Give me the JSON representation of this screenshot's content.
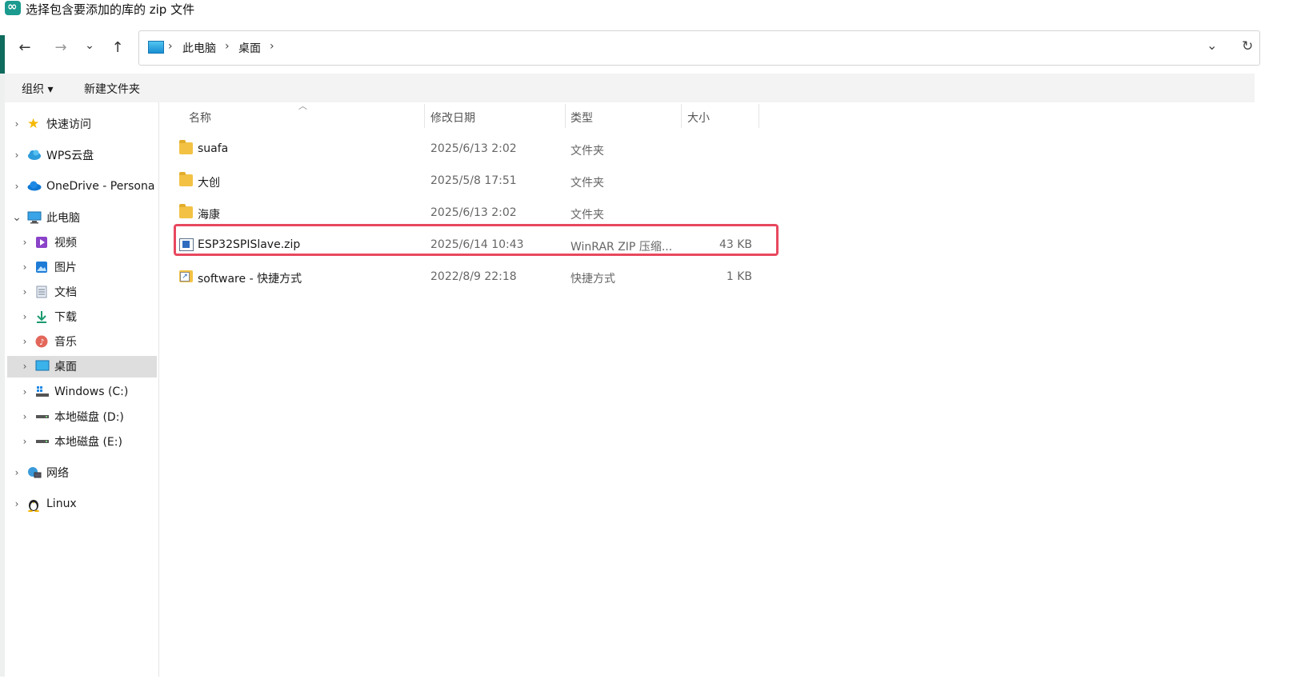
{
  "window": {
    "title": "选择包含要添加的库的 zip 文件"
  },
  "nav": {
    "back_icon": "←",
    "forward_icon": "→",
    "recent_icon": "⌄",
    "up_icon": "↑",
    "breadcrumb": [
      "此电脑",
      "桌面"
    ],
    "sep": "›",
    "dropdown_icon": "⌄",
    "refresh_icon": "↻"
  },
  "toolbar": {
    "organize_label": "组织 ▾",
    "new_folder_label": "新建文件夹"
  },
  "sidebar": {
    "items": [
      {
        "label": "快速访问",
        "expanded": false
      },
      {
        "label": "WPS云盘",
        "expanded": false
      },
      {
        "label": "OneDrive - Persona",
        "expanded": false
      },
      {
        "label": "此电脑",
        "expanded": true
      },
      {
        "label": "视频",
        "expanded": false
      },
      {
        "label": "图片",
        "expanded": false
      },
      {
        "label": "文档",
        "expanded": false
      },
      {
        "label": "下载",
        "expanded": false
      },
      {
        "label": "音乐",
        "expanded": false
      },
      {
        "label": "桌面",
        "expanded": false,
        "selected": true
      },
      {
        "label": "Windows (C:)",
        "expanded": false
      },
      {
        "label": "本地磁盘 (D:)",
        "expanded": false
      },
      {
        "label": "本地磁盘 (E:)",
        "expanded": false
      },
      {
        "label": "网络",
        "expanded": false
      },
      {
        "label": "Linux",
        "expanded": false
      }
    ],
    "chev_collapsed": "›",
    "chev_expanded": "⌄"
  },
  "columns": {
    "name": "名称",
    "modified": "修改日期",
    "type": "类型",
    "size": "大小"
  },
  "files": [
    {
      "name": "suafa",
      "modified": "2025/6/13 2:02",
      "type": "文件夹",
      "size": "",
      "icon": "folder-icon"
    },
    {
      "name": "大创",
      "modified": "2025/5/8 17:51",
      "type": "文件夹",
      "size": "",
      "icon": "folder-icon"
    },
    {
      "name": "海康",
      "modified": "2025/6/13 2:02",
      "type": "文件夹",
      "size": "",
      "icon": "folder-icon"
    },
    {
      "name": "ESP32SPISlave.zip",
      "modified": "2025/6/14 10:43",
      "type": "WinRAR ZIP 压缩...",
      "size": "43 KB",
      "icon": "zip-file-icon",
      "highlighted": true
    },
    {
      "name": "software - 快捷方式",
      "modified": "2022/8/9 22:18",
      "type": "快捷方式",
      "size": "1 KB",
      "icon": "shortcut-icon"
    }
  ],
  "colors": {
    "highlight": "#e8485e",
    "accent": "#0f6b5e",
    "selected_bg": "#dedede"
  }
}
